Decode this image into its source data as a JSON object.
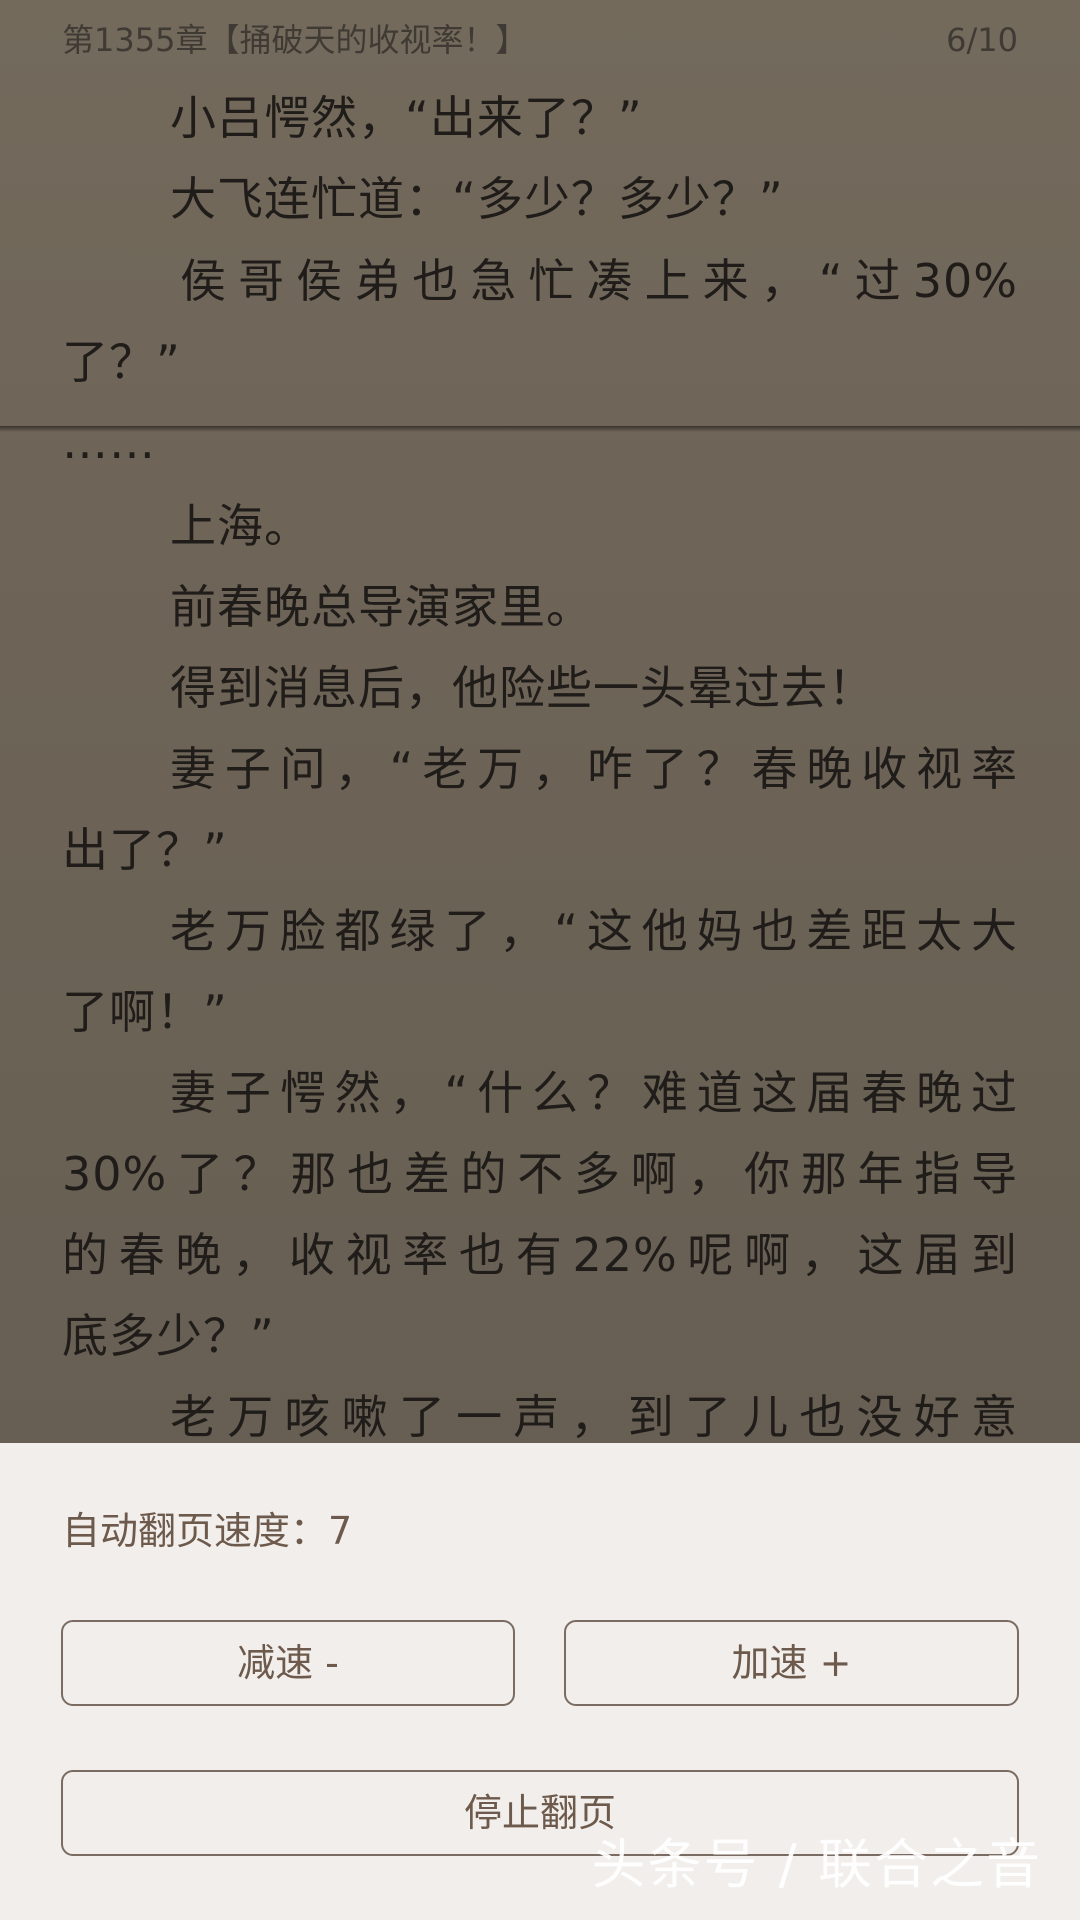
{
  "header": {
    "chapter_title": "第1355章【捅破天的收视率！】",
    "page_indicator": "6/10"
  },
  "text_lines": [
    "小吕愕然，“出来了？”",
    "大飞连忙道：“多少？多少？”",
    "侯哥侯弟也急忙凑上来，“过30%",
    "了？”",
    "……",
    "上海。",
    "前春晚总导演家里。",
    "得到消息后，他险些一头晕过去！",
    "妻子问，“老万，咋了？春晚收视率",
    "出了？”",
    "老万脸都绿了，“这他妈也差距太大",
    "了啊！”",
    "妻子愕然，“什么？难道这届春晚过",
    "30%了？那也差的不多啊，你那年指导",
    "的春晚，收视率也有22%呢啊，这届到",
    "底多少？”",
    "老万咳嗽了一声，到了儿也没好意"
  ],
  "auto_page": {
    "speed_label": "自动翻页速度：7",
    "slow_button": "减速 -",
    "fast_button": "加速 +",
    "stop_button": "停止翻页"
  },
  "watermark": "头条号 / 联合之音"
}
